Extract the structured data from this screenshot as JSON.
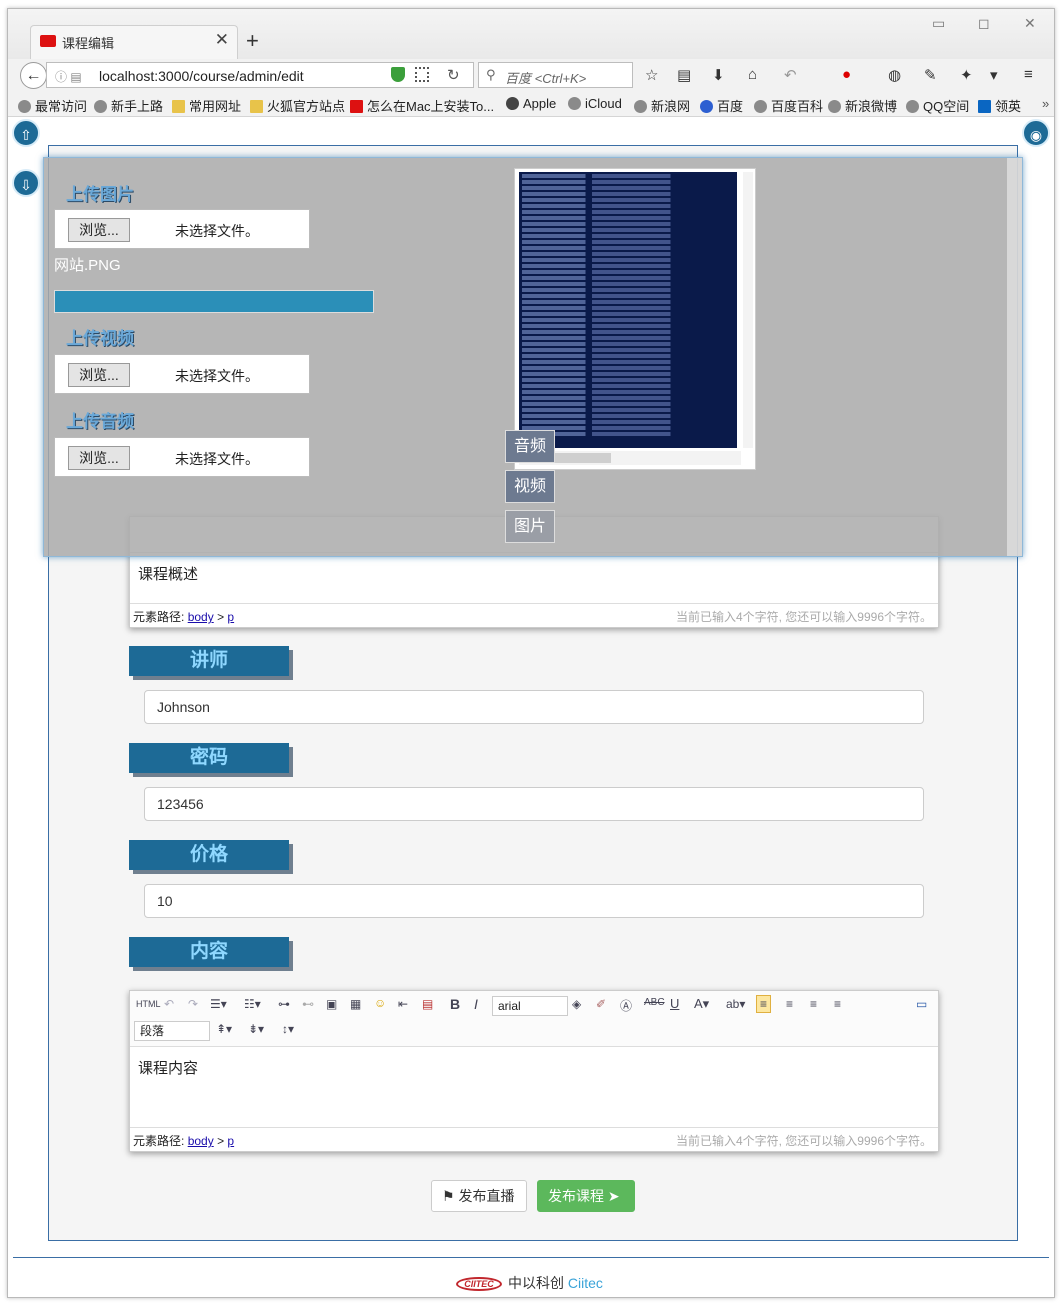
{
  "browser": {
    "tab_title": "课程编辑",
    "url": "localhost:3000/course/admin/edit",
    "search_placeholder": "百度 <Ctrl+K>"
  },
  "bookmarks": [
    "最常访问",
    "新手上路",
    "常用网址",
    "火狐官方站点",
    "怎么在Mac上安装To...",
    "Apple",
    "iCloud",
    "新浪网",
    "百度",
    "百度百科",
    "新浪微博",
    "QQ空间",
    "领英"
  ],
  "overlay": {
    "upload_image_label": "上传图片",
    "upload_video_label": "上传视频",
    "upload_audio_label": "上传音频",
    "browse_label": "浏览...",
    "no_file_label": "未选择文件。",
    "selected_file": "网站.PNG",
    "upload_progress": 1.0,
    "media_tabs": [
      "音频",
      "视频",
      "图片"
    ]
  },
  "form": {
    "summary_editor": {
      "content": "课程概述",
      "path_label": "元素路径:",
      "path_body": "body",
      "path_sep": ">",
      "path_p": "p",
      "counter": "当前已输入4个字符, 您还可以输入9996个字符。"
    },
    "teacher": {
      "label": "讲师",
      "value": "Johnson"
    },
    "password": {
      "label": "密码",
      "value": "123456"
    },
    "price": {
      "label": "价格",
      "value": "10"
    },
    "content_section": {
      "label": "内容"
    },
    "content_editor": {
      "content": "课程内容",
      "font": "arial",
      "paragraph": "段落",
      "path_label": "元素路径:",
      "path_body": "body",
      "path_sep": ">",
      "path_p": "p",
      "counter": "当前已输入4个字符, 您还可以输入9996个字符。"
    },
    "buttons": {
      "live": "发布直播",
      "publish": "发布课程"
    }
  },
  "footer": {
    "logo": "CIITEC",
    "name": "中以科创",
    "name_en": "Ciitec"
  }
}
